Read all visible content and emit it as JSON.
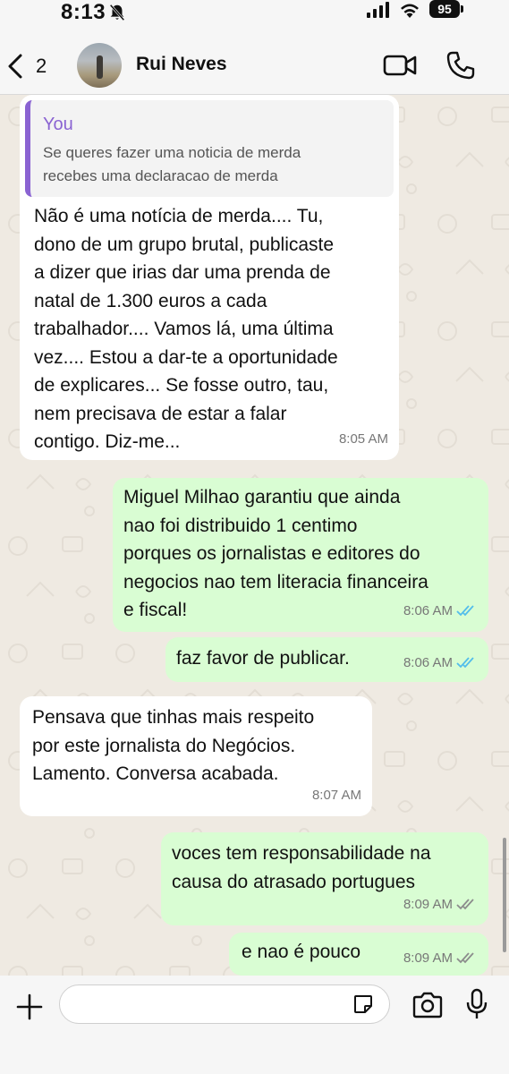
{
  "status_bar": {
    "time": "8:13",
    "battery": "95",
    "icons": [
      "bell-slash-icon",
      "signal-icon",
      "wifi-icon",
      "battery-icon"
    ]
  },
  "header": {
    "back_count": "2",
    "contact_name": "Rui Neves",
    "icons": [
      "chevron-left-icon",
      "video-call-icon",
      "phone-icon"
    ]
  },
  "messages": [
    {
      "direction": "incoming",
      "quote": {
        "author": "You",
        "text": "Se queres fazer uma noticia de merda\nrecebes uma declaracao de merda"
      },
      "text": "Não é uma notícia de merda.... Tu,\ndono de um grupo brutal, publicaste\na dizer que irias dar uma prenda de\nnatal de 1.300 euros a cada\ntrabalhador.... Vamos lá, uma última\nvez.... Estou a dar-te a oportunidade\nde explicares... Se fosse outro, tau,\nnem precisava de estar a falar\ncontigo. Diz-me...",
      "time": "8:05 AM"
    },
    {
      "direction": "outgoing",
      "text": "Miguel Milhao garantiu que ainda\nnao foi distribuido 1 centimo\nporques os jornalistas e editores do\nnegocios nao tem literacia financeira\ne fiscal!",
      "time": "8:06 AM",
      "status": "read"
    },
    {
      "direction": "outgoing",
      "text": "faz favor de publicar.",
      "time": "8:06 AM",
      "status": "read"
    },
    {
      "direction": "incoming",
      "text": "Pensava que tinhas mais respeito\npor este jornalista do Negócios.\nLamento. Conversa acabada.",
      "time": "8:07 AM"
    },
    {
      "direction": "outgoing",
      "text": "voces tem responsabilidade na\ncausa do atrasado portugues",
      "time": "8:09 AM",
      "status": "delivered"
    },
    {
      "direction": "outgoing",
      "text": "e nao é pouco",
      "time": "8:09 AM",
      "status": "delivered"
    }
  ],
  "input_bar": {
    "placeholder": "",
    "icons": [
      "plus-icon",
      "sticker-icon",
      "camera-icon",
      "microphone-icon"
    ]
  },
  "colors": {
    "chat_background": "#efeae2",
    "incoming_bubble": "#ffffff",
    "outgoing_bubble": "#d9fdd3",
    "read_ticks": "#53bdeb",
    "delivered_ticks": "#8c8c8c",
    "quote_accent": "#8a63d2"
  }
}
